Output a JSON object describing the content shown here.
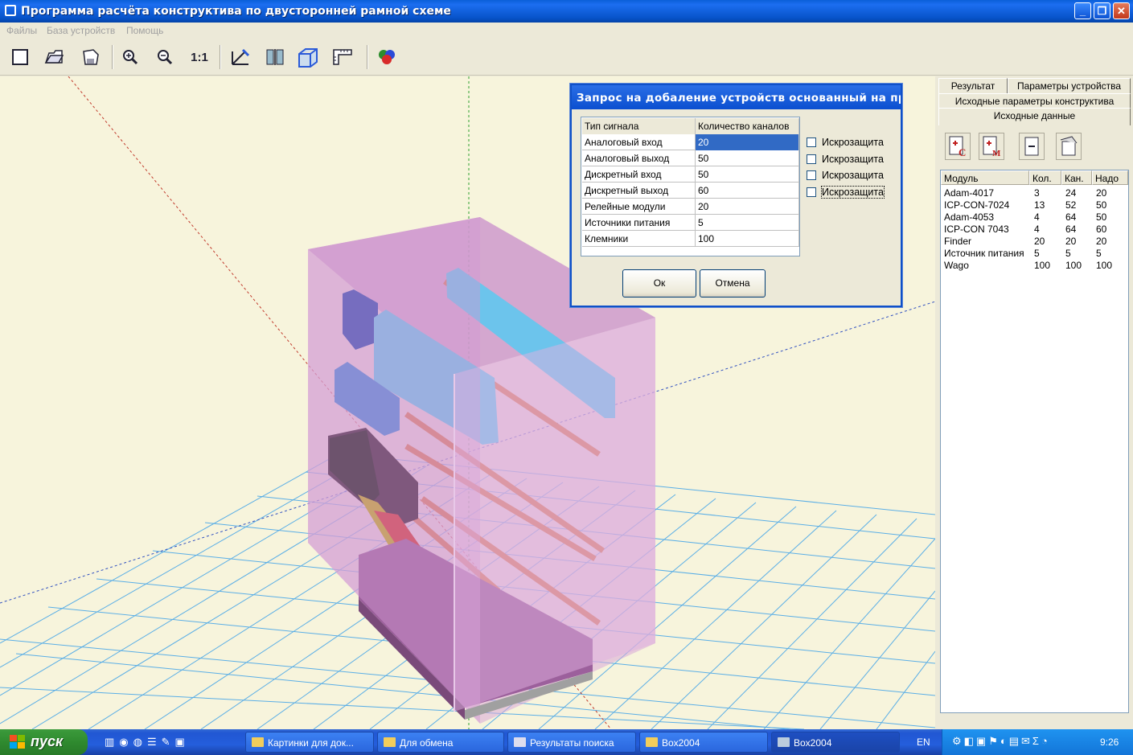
{
  "window": {
    "title": "Программа расчёта конструктива по двусторонней рамной схеме"
  },
  "menu": [
    "Файлы",
    "База устройств",
    "Помощь"
  ],
  "toolbar": {
    "zoom_label": "1:1"
  },
  "dialog": {
    "title": "Запрос на добаление устройств основанный на предп...",
    "columns": [
      "Тип сигнала",
      "Количество каналов"
    ],
    "rows": [
      {
        "type": "Аналоговый вход",
        "count": "20"
      },
      {
        "type": "Аналоговый выход",
        "count": "50"
      },
      {
        "type": "Дискретный вход",
        "count": "50"
      },
      {
        "type": "Дискретный выход",
        "count": "60"
      },
      {
        "type": "Релейные модули",
        "count": "20"
      },
      {
        "type": "Источники питания",
        "count": "5"
      },
      {
        "type": "Клемники",
        "count": "100"
      }
    ],
    "checkbox_label": "Искрозащита",
    "ok": "Ок",
    "cancel": "Отмена"
  },
  "panel": {
    "tabs": [
      "Результат",
      "Параметры устройства",
      "Исходные параметры конструктива",
      "Исходные данные"
    ],
    "columns": [
      "Модуль",
      "Кол.",
      "Кан.",
      "Надо"
    ],
    "rows": [
      {
        "module": "Adam-4017",
        "qty": "3",
        "ch": "24",
        "need": "20"
      },
      {
        "module": "ICP-CON-7024",
        "qty": "13",
        "ch": "52",
        "need": "50"
      },
      {
        "module": "Adam-4053",
        "qty": "4",
        "ch": "64",
        "need": "50"
      },
      {
        "module": "ICP-CON 7043",
        "qty": "4",
        "ch": "64",
        "need": "60"
      },
      {
        "module": "Finder",
        "qty": "20",
        "ch": "20",
        "need": "20"
      },
      {
        "module": "Источник питания",
        "qty": "5",
        "ch": "5",
        "need": "5"
      },
      {
        "module": "Wago",
        "qty": "100",
        "ch": "100",
        "need": "100"
      }
    ]
  },
  "taskbar": {
    "start": "пуск",
    "tasks": [
      "Картинки для док...",
      "Для обмена",
      "Результаты поиска",
      "Box2004",
      "Box2004"
    ],
    "lang": "EN",
    "clock": "9:26"
  }
}
